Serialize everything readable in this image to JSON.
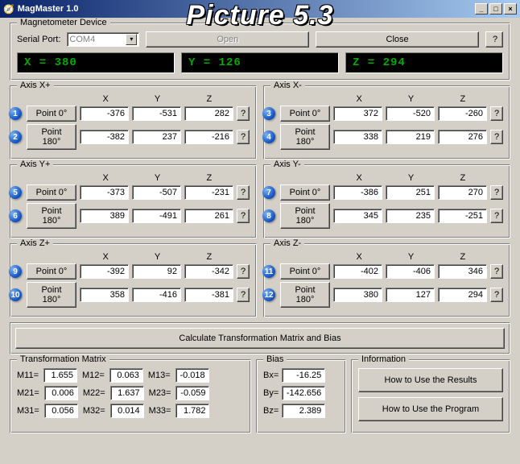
{
  "window_title": "MagMaster 1.0",
  "overlay_caption": "Picture 5.3",
  "device": {
    "legend": "Magnetometer Device",
    "serial_label": "Serial Port:",
    "serial_value": "COM4",
    "open": "Open",
    "close": "Close",
    "help": "?"
  },
  "lcd": {
    "x": "X = 380",
    "y": "Y = 126",
    "z": "Z = 294"
  },
  "headers": {
    "x": "X",
    "y": "Y",
    "z": "Z"
  },
  "point0_label": "Point 0°",
  "point180_label": "Point 180°",
  "q": "?",
  "axes": [
    {
      "name": "Axis X+",
      "p0": {
        "x": "-376",
        "y": "-531",
        "z": "282"
      },
      "p180": {
        "x": "-382",
        "y": "237",
        "z": "-216"
      },
      "badges": [
        "1",
        "2"
      ]
    },
    {
      "name": "Axis X-",
      "p0": {
        "x": "372",
        "y": "-520",
        "z": "-260"
      },
      "p180": {
        "x": "338",
        "y": "219",
        "z": "276"
      },
      "badges": [
        "3",
        "4"
      ]
    },
    {
      "name": "Axis Y+",
      "p0": {
        "x": "-373",
        "y": "-507",
        "z": "-231"
      },
      "p180": {
        "x": "389",
        "y": "-491",
        "z": "261"
      },
      "badges": [
        "5",
        "6"
      ]
    },
    {
      "name": "Axis Y-",
      "p0": {
        "x": "-386",
        "y": "251",
        "z": "270"
      },
      "p180": {
        "x": "345",
        "y": "235",
        "z": "-251"
      },
      "badges": [
        "7",
        "8"
      ]
    },
    {
      "name": "Axis Z+",
      "p0": {
        "x": "-392",
        "y": "92",
        "z": "-342"
      },
      "p180": {
        "x": "358",
        "y": "-416",
        "z": "-381"
      },
      "badges": [
        "9",
        "10"
      ]
    },
    {
      "name": "Axis Z-",
      "p0": {
        "x": "-402",
        "y": "-406",
        "z": "346"
      },
      "p180": {
        "x": "380",
        "y": "127",
        "z": "294"
      },
      "badges": [
        "11",
        "12"
      ]
    }
  ],
  "calc_button": "Calculate Transformation Matrix and Bias",
  "matrix": {
    "legend": "Transformation Matrix",
    "m11_l": "M11=",
    "m11": "1.655",
    "m12_l": "M12=",
    "m12": "0.063",
    "m13_l": "M13=",
    "m13": "-0.018",
    "m21_l": "M21=",
    "m21": "0.006",
    "m22_l": "M22=",
    "m22": "1.637",
    "m23_l": "M23=",
    "m23": "-0.059",
    "m31_l": "M31=",
    "m31": "0.056",
    "m32_l": "M32=",
    "m32": "0.014",
    "m33_l": "M33=",
    "m33": "1.782"
  },
  "bias": {
    "legend": "Bias",
    "bx_l": "Bx=",
    "bx": "-16.25",
    "by_l": "By=",
    "by": "-142.656",
    "bz_l": "Bz=",
    "bz": "2.389"
  },
  "info": {
    "legend": "Information",
    "results": "How to Use the Results",
    "program": "How to Use the Program"
  }
}
